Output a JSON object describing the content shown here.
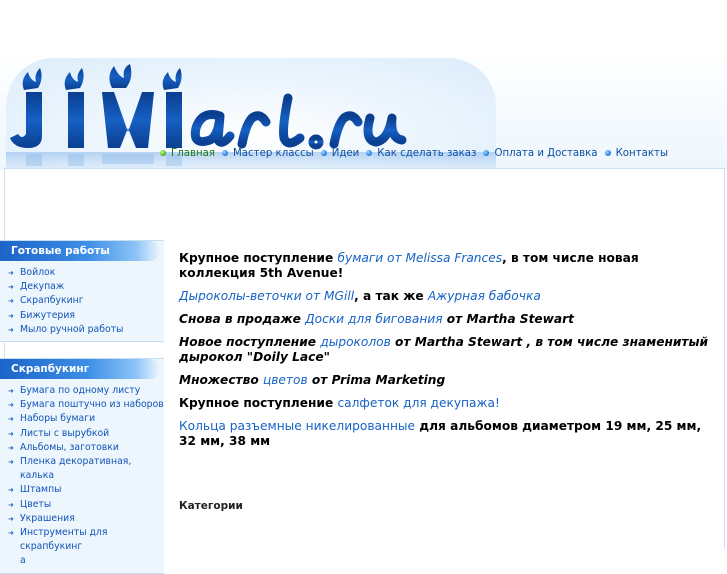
{
  "brand": {
    "logo_text": "Jimiart.ru"
  },
  "topnav": [
    {
      "label": "Главная",
      "active": true
    },
    {
      "label": "Мастер классы",
      "active": false
    },
    {
      "label": "Идеи",
      "active": false
    },
    {
      "label": "Как сделать заказ",
      "active": false
    },
    {
      "label": "Оплата и Доставка",
      "active": false
    },
    {
      "label": "Контакты",
      "active": false
    }
  ],
  "sidebar": {
    "block1": {
      "title": "Готовые работы",
      "items": [
        "Войлок",
        "Декупаж",
        "Скрапбукинг",
        "Бижутерия",
        "Мыло ручной работы"
      ]
    },
    "block2": {
      "title": "Скрапбукинг",
      "items": [
        "Бумага по одному листу",
        "Бумага поштучно из наборов",
        "Наборы бумаги",
        "Листы с вырубкой",
        "Альбомы, заготовки",
        "Пленка декоративная, калька",
        "Штампы",
        "Цветы",
        "Украшения",
        "Инструменты для скрапбукинг",
        "а"
      ]
    }
  },
  "news": [
    {
      "t1": "Крупное поступление ",
      "l1": "бумаги от Melissa Frances",
      "t2": ", в том числе новая коллекция 5th Avenue!",
      "l2": "",
      "t3": ""
    },
    {
      "t1": "",
      "l1": "Дыроколы-веточки от MGill",
      "t2": ", а так же ",
      "l2": "Ажурная бабочка",
      "t3": ""
    },
    {
      "t1": "Снова в продаже ",
      "l1": "Доски для бигования",
      "t2": " от Martha Stewart",
      "l2": "",
      "t3": ""
    },
    {
      "t1": "Новое поступление ",
      "l1": "дыроколов",
      "t2": " от Martha Stewart , в том числе знаменитый дырокол \"Doily Lace\"",
      "l2": "",
      "t3": ""
    },
    {
      "t1": "Множество ",
      "l1": "цветов",
      "t2": " от Prima Marketing",
      "l2": "",
      "t3": ""
    },
    {
      "t1": "Крупное поступление ",
      "l1": "салфеток для декупажа!",
      "t2": "",
      "l2": "",
      "t3": ""
    },
    {
      "t1": "",
      "l1": "Кольца разъемные никелированные",
      "t2": " для альбомов диаметром 19 мм, 25 мм, 32 мм, 38 мм",
      "l2": "",
      "t3": ""
    }
  ],
  "categories_label": "Категории",
  "colors": {
    "link": "#1663c6",
    "nav": "#0d4fa3",
    "nav_active": "#1c7a14",
    "header_bar": "#1c64c8"
  }
}
